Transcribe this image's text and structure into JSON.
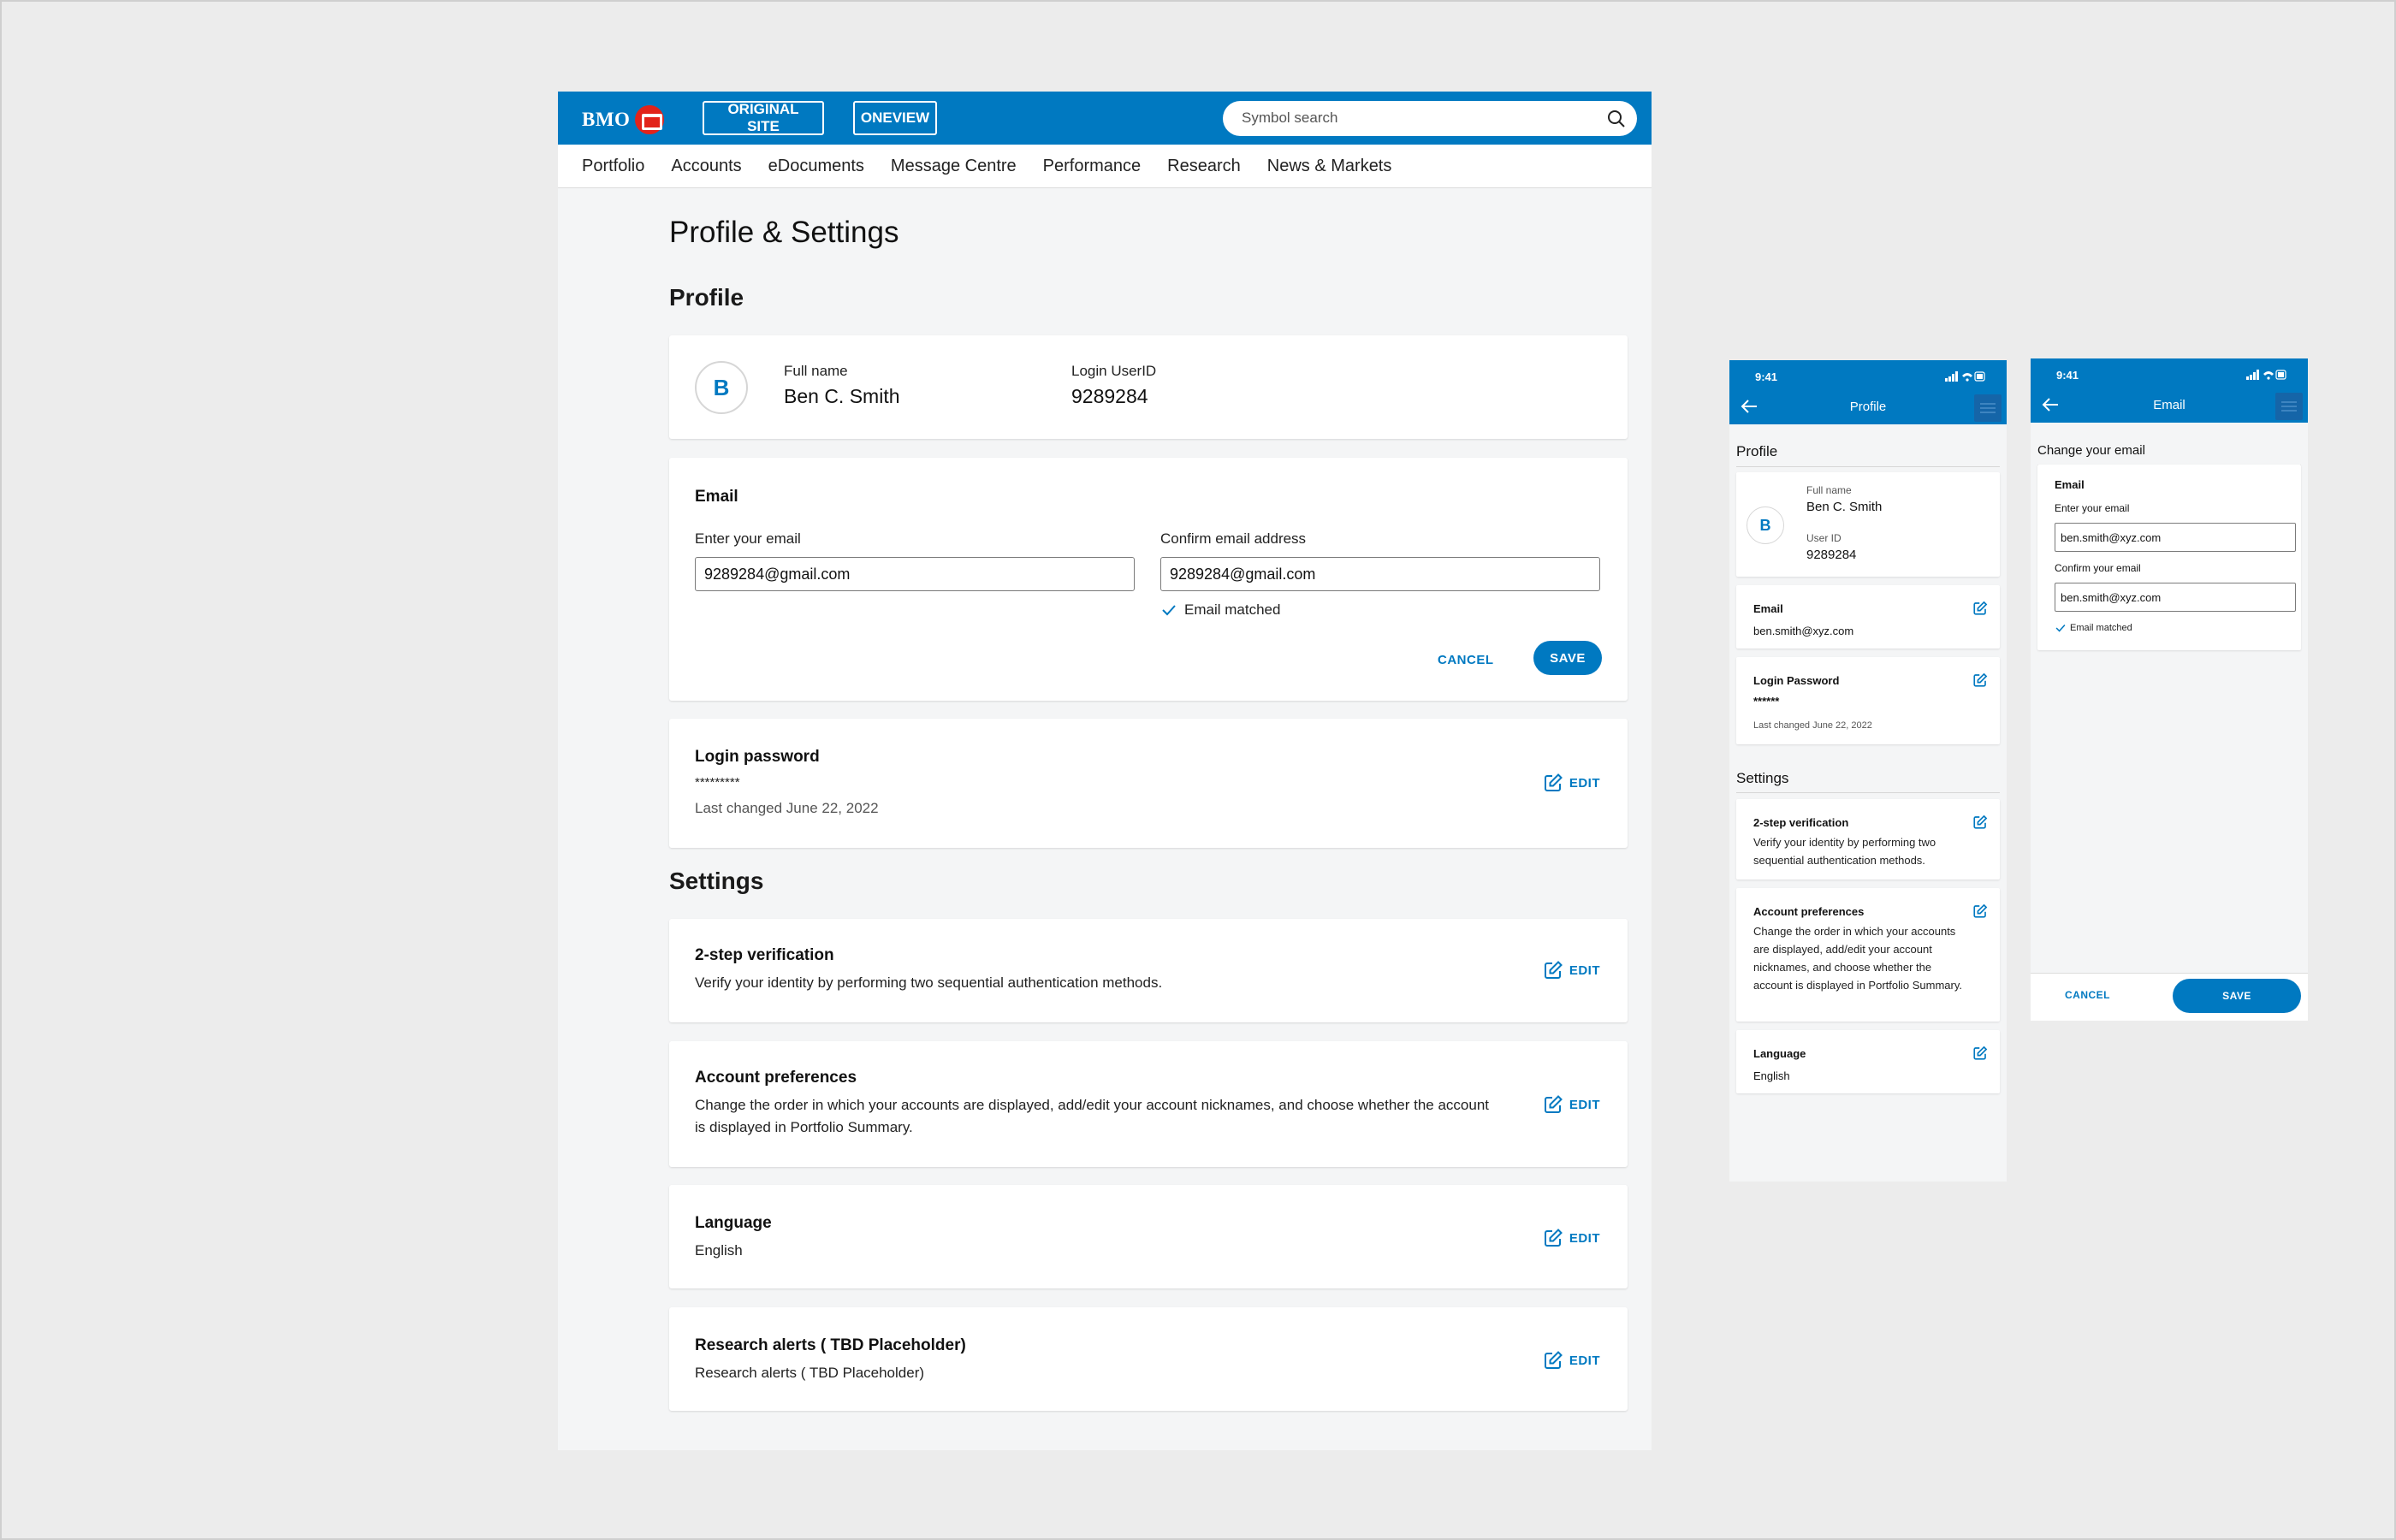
{
  "brand": {
    "logo_text": "BMO",
    "accent_color": "#0079c1",
    "roundel_color": "#e2231a"
  },
  "topbar": {
    "original_site_label": "ORIGINAL SITE",
    "oneview_label": "ONEVIEW",
    "search_placeholder": "Symbol search"
  },
  "nav": {
    "items": [
      "Portfolio",
      "Accounts",
      "eDocuments",
      "Message Centre",
      "Performance",
      "Research",
      "News & Markets"
    ]
  },
  "page": {
    "title": "Profile & Settings",
    "profile_section": "Profile",
    "settings_section": "Settings"
  },
  "profile": {
    "avatar_letter": "B",
    "full_name_label": "Full name",
    "full_name": "Ben C. Smith",
    "userid_label": "Login UserID",
    "userid": "9289284"
  },
  "email_card": {
    "heading": "Email",
    "enter_label": "Enter your email",
    "enter_value": "9289284@gmail.com",
    "confirm_label": "Confirm email address",
    "confirm_value": "9289284@gmail.com",
    "match_text": "Email matched",
    "cancel_label": "CANCEL",
    "save_label": "SAVE"
  },
  "password_card": {
    "heading": "Login password",
    "mask": "*********",
    "last_changed": "Last changed  June 22, 2022",
    "edit_label": "EDIT"
  },
  "settings": {
    "two_step": {
      "heading": "2-step verification",
      "text": "Verify your identity by performing two sequential authentication methods.",
      "edit_label": "EDIT"
    },
    "account_prefs": {
      "heading": "Account preferences",
      "text": "Change the order in which your accounts are displayed, add/edit your account nicknames, and choose whether the account is displayed in Portfolio Summary.",
      "edit_label": "EDIT"
    },
    "language": {
      "heading": "Language",
      "text": "English",
      "edit_label": "EDIT"
    },
    "research_alerts": {
      "heading": "Research alerts ( TBD Placeholder)",
      "text": "Research alerts ( TBD Placeholder)",
      "edit_label": "EDIT"
    }
  },
  "mobile_profile": {
    "time": "9:41",
    "title": "Profile",
    "profile_section": "Profile",
    "avatar_letter": "B",
    "full_name_label": "Full name",
    "full_name": "Ben C. Smith",
    "userid_label": "User ID",
    "userid": "9289284",
    "email_heading": "Email",
    "email_value": "ben.smith@xyz.com",
    "password_heading": "Login Password",
    "password_mask": "******",
    "password_last_changed": "Last changed  June 22, 2022",
    "settings_section": "Settings",
    "two_step_heading": "2-step verification",
    "two_step_text": "Verify your identity by performing two sequential authentication methods.",
    "prefs_heading": "Account preferences",
    "prefs_text": "Change the order in which your accounts are displayed, add/edit your account nicknames, and choose whether the account is displayed in Portfolio Summary.",
    "language_heading": "Language",
    "language_value": "English"
  },
  "mobile_email": {
    "time": "9:41",
    "title": "Email",
    "section": "Change your email",
    "heading": "Email",
    "enter_label": "Enter your email",
    "enter_value": "ben.smith@xyz.com",
    "confirm_label": "Confirm your email",
    "confirm_value": "ben.smith@xyz.com",
    "match_text": "Email matched",
    "cancel_label": "CANCEL",
    "save_label": "SAVE"
  }
}
